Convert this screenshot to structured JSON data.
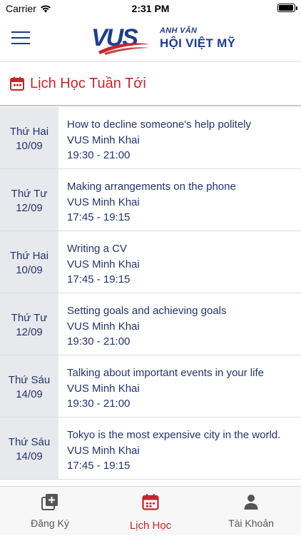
{
  "status_bar": {
    "carrier": "Carrier",
    "time": "2:31 PM",
    "battery_level": 0.95
  },
  "brand": {
    "logo_text": "VUS",
    "tagline_line1": "ANH VĂN",
    "tagline_line2": "HỘI VIỆT MỸ",
    "blue": "#1f3d8a",
    "red": "#c1272d"
  },
  "section": {
    "title": "Lịch Học Tuần Tới",
    "icon": "calendar-icon"
  },
  "schedule": [
    {
      "dow": "Thứ Hai",
      "date": "10/09",
      "title": "How to decline someone's help politely",
      "location": "VUS Minh Khai",
      "time": "19:30 - 21:00"
    },
    {
      "dow": "Thứ Tư",
      "date": "12/09",
      "title": "Making arrangements on the phone",
      "location": "VUS Minh Khai",
      "time": "17:45 - 19:15"
    },
    {
      "dow": "Thứ Hai",
      "date": "10/09",
      "title": "Writing a CV",
      "location": "VUS Minh Khai",
      "time": "17:45 - 19:15"
    },
    {
      "dow": "Thứ Tư",
      "date": "12/09",
      "title": "Setting goals and achieving goals",
      "location": "VUS Minh Khai",
      "time": "19:30 - 21:00"
    },
    {
      "dow": "Thứ Sáu",
      "date": "14/09",
      "title": "Talking about important events in your life",
      "location": "VUS Minh Khai",
      "time": "19:30 - 21:00"
    },
    {
      "dow": "Thứ Sáu",
      "date": "14/09",
      "title": "Tokyo is the most expensive city in the world.",
      "location": "VUS Minh Khai",
      "time": "17:45 - 19:15"
    }
  ],
  "tabs": [
    {
      "label": "Đăng Ký",
      "icon": "add-square-icon"
    },
    {
      "label": "Lịch Học",
      "icon": "calendar-icon",
      "active": true
    },
    {
      "label": "Tài Khoản",
      "icon": "user-icon"
    }
  ]
}
